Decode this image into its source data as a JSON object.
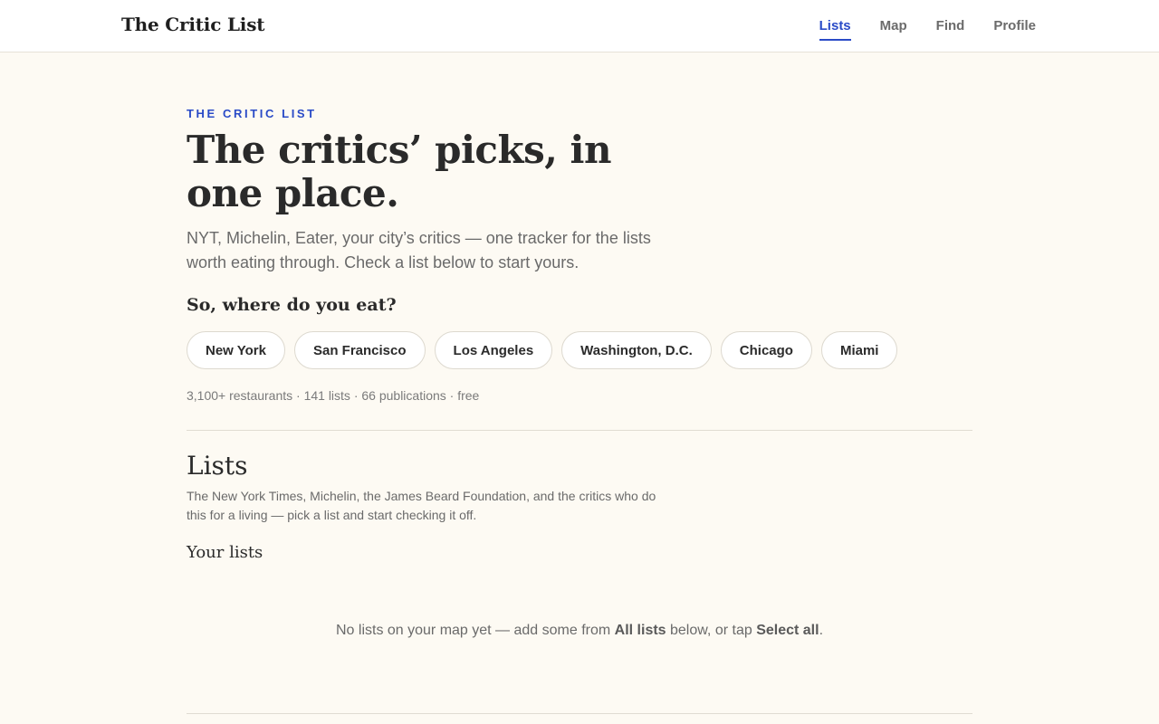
{
  "header": {
    "brand": "The Critic List",
    "nav": [
      "Lists",
      "Map",
      "Find",
      "Profile"
    ],
    "active_nav": "Lists"
  },
  "hero": {
    "eyebrow": "THE CRITIC LIST",
    "headline": "The critics’ picks, in one place.",
    "lede": "NYT, Michelin, Eater, your city’s critics — one tracker for the lists worth eating through. Check a list below to start yours.",
    "question": "So, where do you eat?",
    "cities": [
      "New York",
      "San Francisco",
      "Los Angeles",
      "Washington, D.C.",
      "Chicago",
      "Miami"
    ],
    "stats": "3,100+ restaurants · 141 lists · 66 publications · free"
  },
  "lists": {
    "heading": "Lists",
    "description": "The New York Times, Michelin, the James Beard Foundation, and the critics who do this for a living — pick a list and start checking it off.",
    "your_lists_heading": "Your lists",
    "empty": {
      "prefix": "No lists on your map yet — add some from ",
      "all_lists": "All lists",
      "middle": " below, or tap ",
      "select_all": "Select all",
      "suffix": "."
    }
  },
  "colors": {
    "accent": "#2a4bc7",
    "background": "#fdfaf3"
  }
}
